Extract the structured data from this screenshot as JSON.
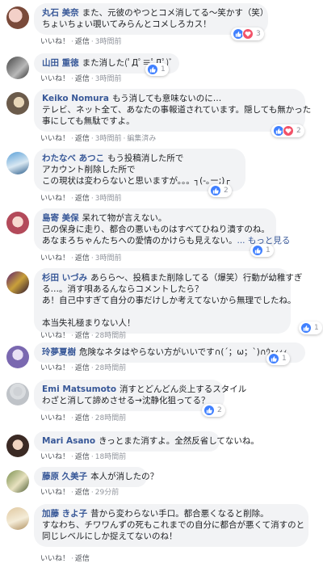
{
  "labels": {
    "like": "いいね！",
    "reply": "返信",
    "edited": "編集済み",
    "dot": "·"
  },
  "comments": [
    {
      "author": "丸石 美奈",
      "lines": [
        "また、元彼のやつとコメ消してる〜笑かす（笑）",
        "ちょいちょい覗いてみらんとコメしろカス！"
      ],
      "time": "3時間前",
      "reactions": {
        "icons": [
          "like-icon",
          "love-icon"
        ],
        "count": "3"
      }
    },
    {
      "author": "山田 重徳",
      "lines": [
        "また消した(ﾟДﾟ≡ﾟДﾟ)ﾞ"
      ],
      "time": "3時間前",
      "reactions": {
        "icons": [
          "like-icon"
        ],
        "count": "1"
      }
    },
    {
      "author": "Keiko Nomura",
      "lines": [
        "もう消しても意味ないのに…",
        "テレビ、ネット全て、あなたの事報道されています。隠しても無かった",
        "事にしても無駄ですよ。"
      ],
      "time": "3時間前",
      "edited": true,
      "reactions": {
        "icons": [
          "like-icon",
          "love-icon"
        ],
        "count": "2"
      }
    },
    {
      "author": "わたなべ あつこ",
      "lines": [
        "もう投稿消した所で",
        "アカウント削除した所で",
        "この現状は変わらないと思いますが。。。┐(-｡ー;)┌"
      ],
      "time": "3時間前",
      "reactions": {
        "icons": [
          "like-icon"
        ],
        "count": "2"
      }
    },
    {
      "author": "島寄 美保",
      "lines": [
        "呆れて物が言えない。",
        "己の保身に走り、都合の悪いものはすべてひねり潰すのね。",
        "あなまろちゃんたちへの愛情のかけらも見えない。"
      ],
      "more": "... もっと見る",
      "time": "3時間前",
      "reactions": {
        "icons": [
          "like-icon"
        ],
        "count": "1"
      }
    },
    {
      "author": "杉田 いづみ",
      "lines": [
        "あらら〜、投稿また削除してる（爆笑）行動が幼稚すぎ",
        "る…。消す唄あるんならコメントしたら？",
        "あ！自己中すぎて自分の事だけしか考えてないから無理でしたね。",
        "",
        "本当失礼極まりない人！"
      ],
      "time": "28時間前",
      "reactions": {
        "icons": [
          "like-icon"
        ],
        "count": "1"
      }
    },
    {
      "author": "玲夢夏樹",
      "lines": [
        "危険なネタはやらない方がいいです∩(´；ω；`)∩ｳｪｨｨｨ"
      ],
      "time": "28時間前",
      "reactions": {
        "icons": [
          "like-icon"
        ],
        "count": "1"
      }
    },
    {
      "author": "Emi Matsumoto",
      "lines": [
        "消すとどんどん炎上するスタイル",
        "わざと消して諦めさせる→沈静化狙ってる？"
      ],
      "time": "28時間前",
      "reactions": {
        "icons": [
          "like-icon"
        ],
        "count": "2"
      }
    },
    {
      "author": "Mari Asano",
      "lines": [
        "きっとまた消すよ。全然反省してないね。"
      ],
      "time": "18時間前",
      "reactions": null
    },
    {
      "author": "藤原 久美子",
      "lines": [
        "本人が消したの？"
      ],
      "time": "29分前",
      "reactions": null
    },
    {
      "author": "加藤 きよ子",
      "lines": [
        "昔から変わらない手口。都合悪くなると削除。",
        "すなわち、チワワんずの死もこれまでの自分に都合が悪くて消すのと",
        "同じレベルにしか捉えてないのね！"
      ],
      "time": "",
      "reactions": null
    }
  ]
}
